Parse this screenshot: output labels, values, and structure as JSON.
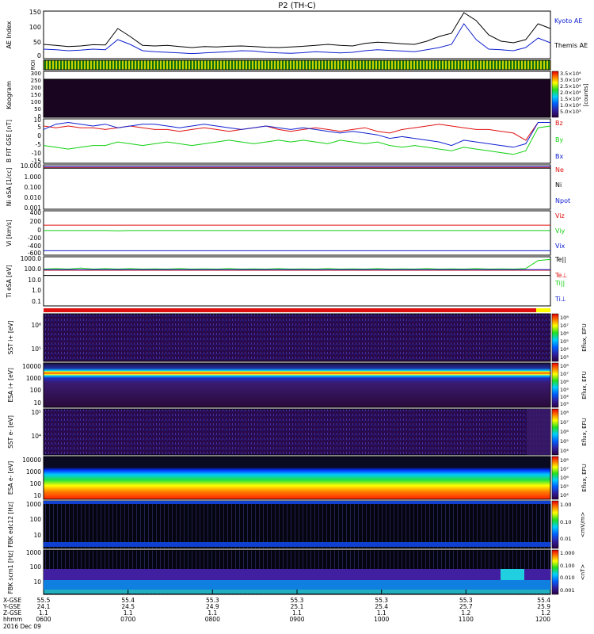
{
  "title": "P2 (TH-C)",
  "date_label": "2016 Dec 09",
  "colors": {
    "black": "#000000",
    "blue": "#1020d0",
    "red": "#e01010",
    "green": "#10d010",
    "navy": "#1a1a6e",
    "purple": "#2a0a3a"
  },
  "chart_data": [
    {
      "type": "line",
      "panel": "ae",
      "ylabel": "AE Index",
      "yticks": [
        "150",
        "100",
        "50",
        "0"
      ],
      "ylim": [
        0,
        150
      ],
      "xlim": [
        "0600",
        "1200"
      ],
      "series": [
        {
          "name": "Kyoto AE",
          "color": "#000000",
          "values": [
            45,
            42,
            38,
            40,
            44,
            43,
            95,
            70,
            42,
            40,
            42,
            38,
            35,
            38,
            37,
            39,
            40,
            38,
            36,
            35,
            37,
            39,
            42,
            45,
            42,
            40,
            48,
            52,
            50,
            47,
            45,
            55,
            70,
            80,
            145,
            120,
            75,
            55,
            50,
            60,
            110,
            95
          ]
        },
        {
          "name": "Themis AE",
          "color": "#1020d0",
          "values": [
            30,
            28,
            25,
            27,
            30,
            28,
            60,
            45,
            25,
            22,
            20,
            18,
            16,
            18,
            20,
            22,
            25,
            24,
            20,
            18,
            17,
            19,
            22,
            20,
            18,
            20,
            25,
            28,
            26,
            24,
            22,
            28,
            35,
            45,
            110,
            60,
            30,
            28,
            25,
            35,
            65,
            50
          ]
        }
      ]
    },
    {
      "type": "line",
      "panel": "b-field",
      "ylabel": "B FIT GSE [nT]",
      "yticks": [
        "10",
        "5",
        "0",
        "-5",
        "-10",
        "-15"
      ],
      "ylim": [
        -15,
        10
      ],
      "xlim": [
        "0600",
        "1200"
      ],
      "series": [
        {
          "name": "Bz",
          "color": "#e01010",
          "values": [
            6,
            5,
            6,
            5,
            5,
            4,
            5,
            6,
            5,
            4,
            4,
            3,
            4,
            5,
            4,
            3,
            4,
            5,
            6,
            4,
            3,
            4,
            5,
            4,
            3,
            4,
            5,
            3,
            2,
            4,
            5,
            6,
            7,
            6,
            5,
            4,
            4,
            3,
            2,
            -2,
            8,
            8
          ]
        },
        {
          "name": "By",
          "color": "#10d010",
          "values": [
            -5,
            -6,
            -7,
            -6,
            -5,
            -5,
            -3,
            -4,
            -5,
            -4,
            -3,
            -4,
            -5,
            -4,
            -3,
            -2,
            -3,
            -4,
            -3,
            -2,
            -3,
            -2,
            -3,
            -4,
            -2,
            -3,
            -4,
            -3,
            -5,
            -6,
            -5,
            -6,
            -7,
            -8,
            -6,
            -7,
            -8,
            -9,
            -10,
            -8,
            5,
            6
          ]
        },
        {
          "name": "Bx",
          "color": "#1020d0",
          "values": [
            4,
            7,
            8,
            7,
            6,
            7,
            5,
            6,
            7,
            7,
            6,
            5,
            6,
            7,
            6,
            5,
            4,
            5,
            6,
            5,
            4,
            5,
            4,
            3,
            2,
            3,
            2,
            1,
            -1,
            0,
            -1,
            -2,
            -3,
            -5,
            -2,
            -3,
            -4,
            -5,
            -6,
            -4,
            8,
            8
          ]
        }
      ]
    },
    {
      "type": "line",
      "panel": "density",
      "ylabel": "Ni eSA [1/cc]",
      "yticks": [
        "10.000",
        "1.000",
        "0.100",
        "0.010",
        "0.001"
      ],
      "ylim": [
        0.001,
        10
      ],
      "scale": "log",
      "xlim": [
        "0600",
        "1200"
      ],
      "series": [
        {
          "name": "Ne",
          "color": "#e01010",
          "values": [
            6,
            6,
            6,
            6,
            6,
            6,
            6,
            6,
            6,
            6,
            6,
            6,
            6,
            6,
            6,
            6,
            6,
            6,
            6,
            6,
            6,
            6,
            6,
            6,
            6,
            6,
            6,
            6,
            6,
            6,
            6,
            6,
            6,
            6,
            6,
            6,
            6,
            6,
            6,
            6,
            6,
            6
          ]
        },
        {
          "name": "Ni",
          "color": "#000000",
          "values": [
            5,
            5,
            5,
            5,
            5,
            5,
            5,
            5,
            5,
            5,
            5,
            5,
            5,
            5,
            5,
            5,
            5,
            5,
            5,
            5,
            5,
            5,
            5,
            5,
            5,
            5,
            5,
            5,
            5,
            5,
            5,
            5,
            5,
            5,
            5,
            5,
            5,
            5,
            5,
            5,
            5,
            5
          ]
        },
        {
          "name": "Npot",
          "color": "#1020d0",
          "values": [
            7,
            7,
            7,
            7,
            7,
            7,
            7,
            7,
            7,
            7,
            7,
            7,
            7,
            7,
            7,
            7,
            7,
            7,
            7,
            7,
            7,
            7,
            7,
            7,
            7,
            7,
            7,
            7,
            7,
            7,
            7,
            7,
            7,
            7,
            7,
            7,
            7,
            7,
            7,
            7,
            7,
            7
          ]
        }
      ]
    },
    {
      "type": "line",
      "panel": "velocity",
      "ylabel": "Vi [km/s]",
      "yticks": [
        "400",
        "200",
        "0",
        "-200",
        "-400",
        "-600"
      ],
      "ylim": [
        -650,
        450
      ],
      "xlim": [
        "0600",
        "1200"
      ],
      "series": [
        {
          "name": "Viz",
          "color": "#e01010",
          "values": [
            95,
            95,
            95,
            95,
            95,
            95,
            95,
            95,
            95,
            95,
            95,
            95,
            95,
            95,
            95,
            95,
            95,
            95,
            95,
            95,
            95,
            95,
            95,
            95,
            95,
            95,
            95,
            95,
            95,
            95,
            95,
            95,
            95,
            95,
            95,
            95,
            95,
            95,
            95,
            95,
            95,
            95
          ]
        },
        {
          "name": "Viy",
          "color": "#10d010",
          "values": [
            -40,
            -40,
            -40,
            -40,
            -40,
            -40,
            -45,
            -40,
            -40,
            -40,
            -40,
            -40,
            -40,
            -40,
            -40,
            -40,
            -40,
            -40,
            -40,
            -40,
            -40,
            -40,
            -40,
            -40,
            -40,
            -40,
            -40,
            -40,
            -40,
            -40,
            -40,
            -40,
            -40,
            -40,
            -40,
            -40,
            -40,
            -40,
            -40,
            -40,
            -40,
            -40
          ]
        },
        {
          "name": "Vix",
          "color": "#1020d0",
          "values": [
            -540,
            -540,
            -540,
            -540,
            -540,
            -540,
            -540,
            -540,
            -540,
            -540,
            -540,
            -540,
            -540,
            -540,
            -540,
            -540,
            -540,
            -540,
            -540,
            -540,
            -540,
            -540,
            -540,
            -540,
            -540,
            -540,
            -540,
            -540,
            -540,
            -540,
            -540,
            -540,
            -540,
            -540,
            -540,
            -540,
            -540,
            -540,
            -540,
            -540,
            -540,
            -540
          ]
        }
      ]
    },
    {
      "type": "line",
      "panel": "temperature",
      "ylabel": "Ti eSA [eV]",
      "yticks": [
        "1000.0",
        "100.0",
        "10.0",
        "1.0",
        "0.1"
      ],
      "ylim": [
        0.1,
        1000
      ],
      "scale": "log",
      "xlim": [
        "0600",
        "1200"
      ],
      "series": [
        {
          "name": "Te||",
          "color": "#000000",
          "values": [
            30,
            30,
            30,
            30,
            30,
            30,
            30,
            30,
            30,
            30,
            30,
            30,
            30,
            30,
            30,
            30,
            30,
            30,
            30,
            30,
            30,
            30,
            30,
            30,
            30,
            30,
            30,
            30,
            30,
            30,
            30,
            30,
            30,
            30,
            30,
            30,
            30,
            30,
            30,
            30,
            30,
            30
          ]
        },
        {
          "name": "Te⊥",
          "color": "#e01010",
          "values": [
            80,
            80,
            80,
            80,
            80,
            80,
            80,
            80,
            80,
            80,
            80,
            80,
            80,
            80,
            80,
            80,
            80,
            80,
            80,
            80,
            80,
            80,
            80,
            80,
            80,
            80,
            80,
            80,
            80,
            80,
            80,
            80,
            80,
            80,
            80,
            80,
            80,
            80,
            80,
            80,
            80,
            80
          ]
        },
        {
          "name": "Ti||",
          "color": "#10d010",
          "values": [
            100,
            110,
            100,
            120,
            100,
            110,
            100,
            110,
            100,
            105,
            100,
            110,
            100,
            105,
            100,
            110,
            100,
            105,
            100,
            110,
            100,
            105,
            100,
            110,
            100,
            105,
            100,
            110,
            100,
            105,
            100,
            110,
            100,
            105,
            100,
            110,
            100,
            105,
            100,
            110,
            500,
            600
          ]
        },
        {
          "name": "Ti⊥",
          "color": "#1020d0",
          "values": [
            90,
            90,
            90,
            90,
            90,
            90,
            90,
            90,
            90,
            90,
            90,
            90,
            90,
            90,
            90,
            90,
            90,
            90,
            90,
            90,
            90,
            90,
            90,
            90,
            90,
            90,
            90,
            90,
            90,
            90,
            90,
            90,
            90,
            90,
            90,
            90,
            90,
            90,
            90,
            90,
            90,
            90
          ]
        }
      ]
    },
    {
      "type": "heatmap",
      "panel": "keogram",
      "ylabel": "Keogram",
      "yticks": [
        "300",
        "250",
        "200",
        "150",
        "100",
        "50",
        "0"
      ],
      "colorbar_label": "[counts]",
      "colorbar_ticks": [
        "3.5×10⁴",
        "3.0×10⁴",
        "2.5×10⁴",
        "2.0×10⁴",
        "1.5×10⁴",
        "1.0×10⁴",
        "5.0×10³"
      ]
    },
    {
      "type": "heatmap",
      "panel": "sst-ion",
      "ylabel": "SST i+ [eV]",
      "yticks": [
        "10⁶",
        "10⁵"
      ],
      "colorbar_label": "Eflux, EFU",
      "colorbar_ticks": [
        "10⁸",
        "10⁷",
        "10⁶",
        "10⁵",
        "10⁴",
        "10³"
      ]
    },
    {
      "type": "heatmap",
      "panel": "esa-ion",
      "ylabel": "ESA i+ [eV]",
      "yticks": [
        "10000",
        "1000",
        "100",
        "10"
      ],
      "colorbar_label": "Eflux, EFU",
      "colorbar_ticks": [
        "10⁸",
        "10⁷",
        "10⁶",
        "10⁵",
        "10⁴",
        "10³"
      ]
    },
    {
      "type": "heatmap",
      "panel": "sst-elec",
      "ylabel": "SST e- [eV]",
      "yticks": [
        "10⁵",
        "10⁴"
      ],
      "colorbar_label": "Eflux, EFU",
      "colorbar_ticks": [
        "10⁸",
        "10⁷",
        "10⁶",
        "10⁵",
        "10⁴"
      ]
    },
    {
      "type": "heatmap",
      "panel": "esa-elec",
      "ylabel": "ESA e- [eV]",
      "yticks": [
        "10000",
        "1000",
        "100",
        "10"
      ],
      "colorbar_label": "Eflux, EFU",
      "colorbar_ticks": [
        "10⁸",
        "10⁷",
        "10⁶",
        "10⁵",
        "10⁴"
      ]
    },
    {
      "type": "heatmap",
      "panel": "fbk-e",
      "ylabel": "FBK edc12 [Hz]",
      "yticks": [
        "1000",
        "100",
        "10"
      ],
      "colorbar_label": "<mV/m>",
      "colorbar_ticks": [
        "1.00",
        "0.10",
        "0.01"
      ]
    },
    {
      "type": "heatmap",
      "panel": "fbk-b",
      "ylabel": "FBK scm1 [Hz]",
      "yticks": [
        "1000",
        "100",
        "10"
      ],
      "colorbar_label": "<nT>",
      "colorbar_ticks": [
        "1.000",
        "0.100",
        "0.010",
        "0.001"
      ]
    }
  ],
  "roi_label": "ROI",
  "x_axis": {
    "row_labels": [
      "X-GSE",
      "Y-GSE",
      "Z-GSE",
      "hhmm"
    ],
    "columns": [
      {
        "x": "55.5",
        "y": "24.1",
        "z": "1.1",
        "time": "0600"
      },
      {
        "x": "55.4",
        "y": "24.5",
        "z": "1.1",
        "time": "0700"
      },
      {
        "x": "55.3",
        "y": "24.9",
        "z": "1.1",
        "time": "0800"
      },
      {
        "x": "55.3",
        "y": "25.1",
        "z": "1.1",
        "time": "0900"
      },
      {
        "x": "55.3",
        "y": "25.4",
        "z": "1.1",
        "time": "1000"
      },
      {
        "x": "55.3",
        "y": "25.7",
        "z": "1.2",
        "time": "1100"
      },
      {
        "x": "55.4",
        "y": "25.9",
        "z": "1.2",
        "time": "1200"
      }
    ]
  }
}
